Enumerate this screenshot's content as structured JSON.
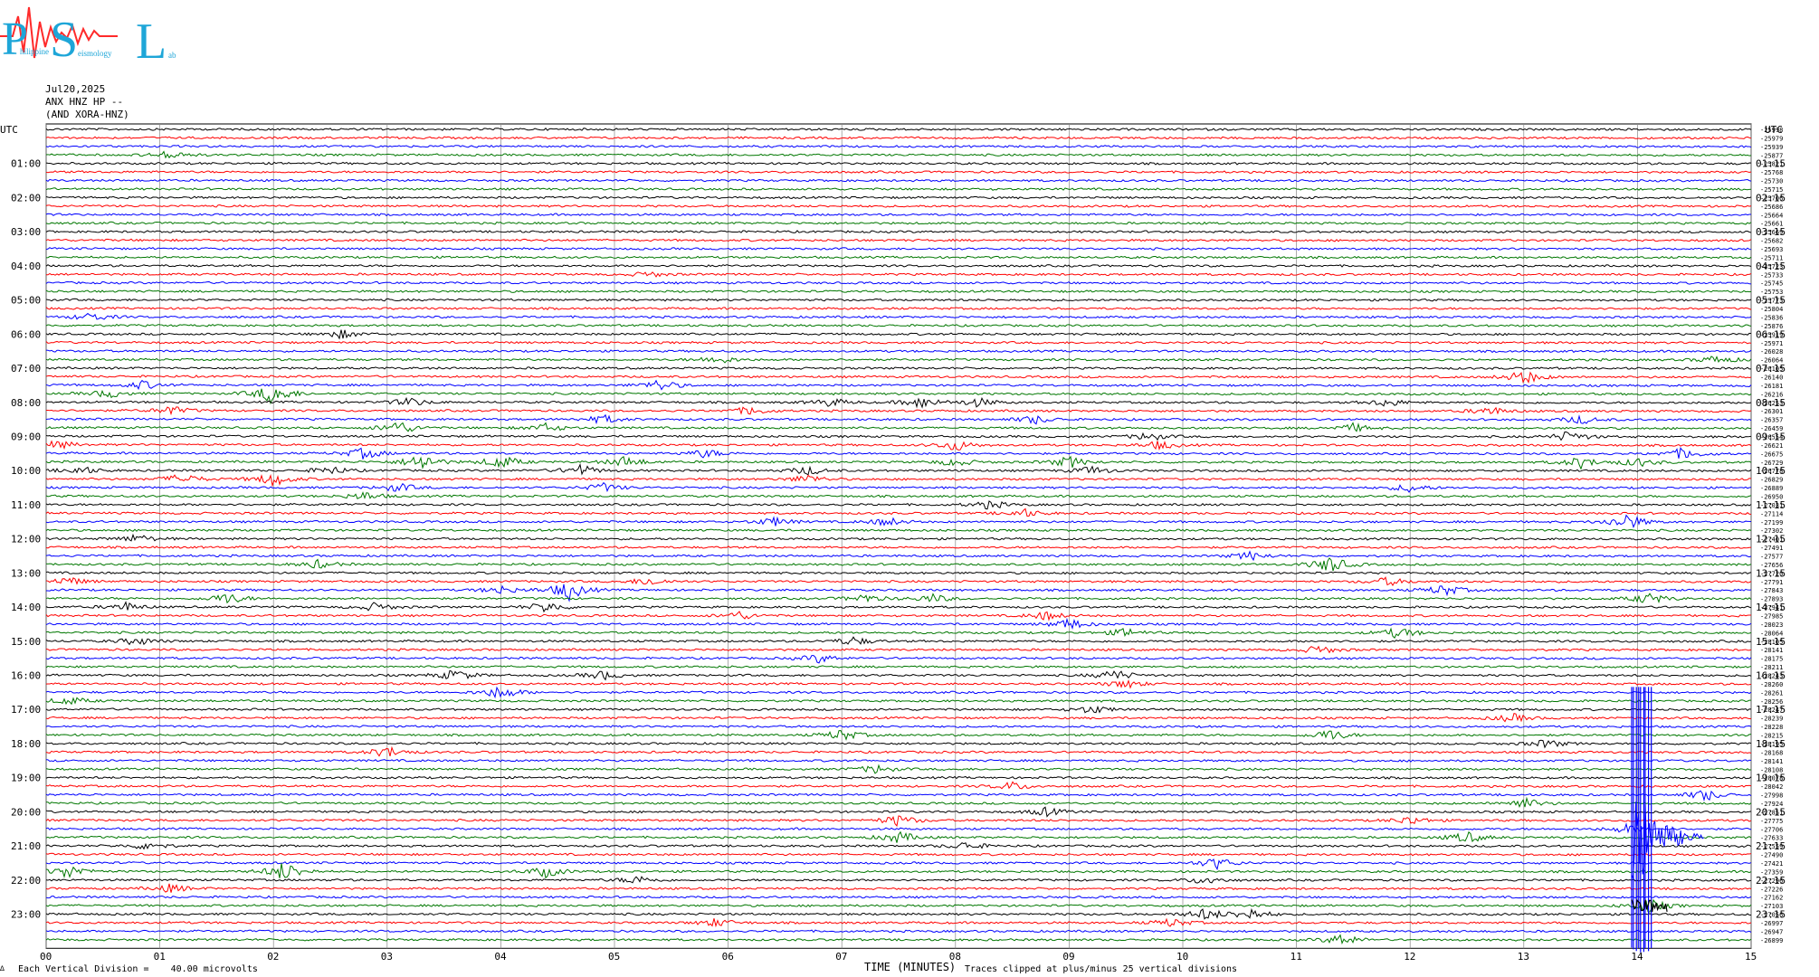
{
  "logo": {
    "letters": [
      "P",
      "S",
      "L"
    ],
    "tail_text": [
      "hilippine",
      "eismology",
      "ab"
    ]
  },
  "header": {
    "date": "Jul20,2025",
    "station": "ANX HNZ HP --",
    "network": "(AND XORA-HNZ)"
  },
  "footer": {
    "scale_prefix": "∆",
    "vertical_division": "Each Vertical Division =    40.00 microvolts",
    "x_label": "TIME (MINUTES)",
    "clip_note": "Traces clipped at plus/minus 25 vertical divisions"
  },
  "colors": {
    "trace_cycle": [
      "#000000",
      "#ff0000",
      "#0000ff",
      "#007700"
    ],
    "grid": "#888888",
    "logo_blue": "#1ea6d8",
    "logo_red": "#ff2a2a"
  },
  "chart_data": {
    "type": "helicorder",
    "corner_labels": {
      "left": "UTC",
      "right": "UTC"
    },
    "x_ticks": [
      "00",
      "01",
      "02",
      "03",
      "04",
      "05",
      "06",
      "07",
      "08",
      "09",
      "10",
      "11",
      "12",
      "13",
      "14",
      "15"
    ],
    "xlim": [
      0,
      15
    ],
    "trace_count": 96,
    "minutes_per_trace": 15,
    "left_hour_labels": [
      "01:00",
      "02:00",
      "03:00",
      "04:00",
      "05:00",
      "06:00",
      "07:00",
      "08:00",
      "09:00",
      "10:00",
      "11:00",
      "12:00",
      "13:00",
      "14:00",
      "15:00",
      "16:00",
      "17:00",
      "18:00",
      "19:00",
      "20:00",
      "21:00",
      "22:00",
      "23:00"
    ],
    "right_hour_labels": [
      "01:15",
      "02:15",
      "03:15",
      "04:15",
      "05:15",
      "06:15",
      "07:15",
      "08:15",
      "09:15",
      "10:15",
      "11:15",
      "12:15",
      "13:15",
      "14:15",
      "15:15",
      "16:15",
      "17:15",
      "18:15",
      "19:15",
      "20:15",
      "21:15",
      "22:15",
      "23:15"
    ],
    "right_offsets": [
      "-25998",
      "-25979",
      "-25939",
      "-25877",
      "-25821",
      "-25768",
      "-25730",
      "-25715",
      "-25706",
      "-25686",
      "-25664",
      "-25661",
      "-25669",
      "-25682",
      "-25693",
      "-25711",
      "-25723",
      "-25733",
      "-25745",
      "-25753",
      "-25773",
      "-25804",
      "-25836",
      "-25876",
      "-25919",
      "-25971",
      "-26028",
      "-26064",
      "-26105",
      "-26140",
      "-26181",
      "-26216",
      "-26253",
      "-26301",
      "-26357",
      "-26459",
      "-26554",
      "-26621",
      "-26675",
      "-26729",
      "-26778",
      "-26829",
      "-26889",
      "-26950",
      "-27031",
      "-27114",
      "-27199",
      "-27302",
      "-27401",
      "-27491",
      "-27577",
      "-27656",
      "-27720",
      "-27791",
      "-27843",
      "-27893",
      "-27941",
      "-27985",
      "-28023",
      "-28064",
      "-28105",
      "-28141",
      "-28175",
      "-28211",
      "-28243",
      "-28260",
      "-28261",
      "-28256",
      "-28247",
      "-28239",
      "-28228",
      "-28215",
      "-28195",
      "-28168",
      "-28141",
      "-28108",
      "-28078",
      "-28042",
      "-27998",
      "-27924",
      "-27851",
      "-27775",
      "-27706",
      "-27633",
      "-27559",
      "-27490",
      "-27421",
      "-27359",
      "-27296",
      "-27226",
      "-27162",
      "-27103",
      "-27056",
      "-26997",
      "-26947",
      "-26899"
    ],
    "events": [
      {
        "trace": 3,
        "minute": 1.1,
        "amp": 3
      },
      {
        "trace": 17,
        "minute": 5.3,
        "amp": 2
      },
      {
        "trace": 22,
        "minute": 0.4,
        "amp": 3
      },
      {
        "trace": 24,
        "minute": 2.6,
        "amp": 3
      },
      {
        "trace": 27,
        "minute": 5.9,
        "amp": 3
      },
      {
        "trace": 29,
        "minute": 13.0,
        "amp": 5
      },
      {
        "trace": 27,
        "minute": 14.7,
        "amp": 3
      },
      {
        "trace": 30,
        "minute": 0.85,
        "amp": 3
      },
      {
        "trace": 30,
        "minute": 5.4,
        "amp": 4
      },
      {
        "trace": 31,
        "minute": 0.55,
        "amp": 3
      },
      {
        "trace": 31,
        "minute": 2.0,
        "amp": 8
      },
      {
        "trace": 32,
        "minute": 6.9,
        "amp": 3
      },
      {
        "trace": 32,
        "minute": 7.7,
        "amp": 4
      },
      {
        "trace": 32,
        "minute": 8.2,
        "amp": 3
      },
      {
        "trace": 32,
        "minute": 11.8,
        "amp": 3
      },
      {
        "trace": 32,
        "minute": 3.2,
        "amp": 3
      },
      {
        "trace": 33,
        "minute": 1.1,
        "amp": 3
      },
      {
        "trace": 33,
        "minute": 6.2,
        "amp": 3
      },
      {
        "trace": 33,
        "minute": 12.7,
        "amp": 3
      },
      {
        "trace": 34,
        "minute": 4.9,
        "amp": 3
      },
      {
        "trace": 34,
        "minute": 8.7,
        "amp": 3
      },
      {
        "trace": 34,
        "minute": 13.5,
        "amp": 3
      },
      {
        "trace": 35,
        "minute": 3.1,
        "amp": 5
      },
      {
        "trace": 35,
        "minute": 11.5,
        "amp": 3
      },
      {
        "trace": 35,
        "minute": 4.4,
        "amp": 3
      },
      {
        "trace": 36,
        "minute": 9.7,
        "amp": 3
      },
      {
        "trace": 36,
        "minute": 13.4,
        "amp": 4
      },
      {
        "trace": 37,
        "minute": 0.1,
        "amp": 3
      },
      {
        "trace": 37,
        "minute": 8.0,
        "amp": 4
      },
      {
        "trace": 37,
        "minute": 9.8,
        "amp": 3
      },
      {
        "trace": 38,
        "minute": 2.8,
        "amp": 4
      },
      {
        "trace": 38,
        "minute": 5.8,
        "amp": 3
      },
      {
        "trace": 38,
        "minute": 14.4,
        "amp": 4
      },
      {
        "trace": 39,
        "minute": 3.3,
        "amp": 6
      },
      {
        "trace": 39,
        "minute": 4.0,
        "amp": 5
      },
      {
        "trace": 39,
        "minute": 5.1,
        "amp": 4
      },
      {
        "trace": 39,
        "minute": 8.0,
        "amp": 3
      },
      {
        "trace": 39,
        "minute": 9.0,
        "amp": 4
      },
      {
        "trace": 39,
        "minute": 13.5,
        "amp": 4
      },
      {
        "trace": 39,
        "minute": 14.0,
        "amp": 3
      },
      {
        "trace": 40,
        "minute": 0.3,
        "amp": 3
      },
      {
        "trace": 40,
        "minute": 2.5,
        "amp": 3
      },
      {
        "trace": 40,
        "minute": 4.7,
        "amp": 4
      },
      {
        "trace": 40,
        "minute": 6.7,
        "amp": 3
      },
      {
        "trace": 40,
        "minute": 9.2,
        "amp": 3
      },
      {
        "trace": 41,
        "minute": 1.2,
        "amp": 4
      },
      {
        "trace": 41,
        "minute": 2.0,
        "amp": 5
      },
      {
        "trace": 41,
        "minute": 6.7,
        "amp": 3
      },
      {
        "trace": 42,
        "minute": 3.1,
        "amp": 3
      },
      {
        "trace": 42,
        "minute": 4.9,
        "amp": 3
      },
      {
        "trace": 42,
        "minute": 12.0,
        "amp": 3
      },
      {
        "trace": 43,
        "minute": 2.8,
        "amp": 3
      },
      {
        "trace": 44,
        "minute": 8.3,
        "amp": 3
      },
      {
        "trace": 45,
        "minute": 8.6,
        "amp": 3
      },
      {
        "trace": 46,
        "minute": 6.4,
        "amp": 3
      },
      {
        "trace": 46,
        "minute": 7.4,
        "amp": 3
      },
      {
        "trace": 46,
        "minute": 13.9,
        "amp": 6
      },
      {
        "trace": 48,
        "minute": 0.8,
        "amp": 3
      },
      {
        "trace": 50,
        "minute": 10.6,
        "amp": 3
      },
      {
        "trace": 51,
        "minute": 11.3,
        "amp": 6
      },
      {
        "trace": 51,
        "minute": 2.4,
        "amp": 3
      },
      {
        "trace": 53,
        "minute": 0.2,
        "amp": 3
      },
      {
        "trace": 53,
        "minute": 11.8,
        "amp": 3
      },
      {
        "trace": 53,
        "minute": 5.3,
        "amp": 3
      },
      {
        "trace": 54,
        "minute": 4.0,
        "amp": 3
      },
      {
        "trace": 54,
        "minute": 4.6,
        "amp": 7
      },
      {
        "trace": 54,
        "minute": 12.3,
        "amp": 4
      },
      {
        "trace": 55,
        "minute": 1.6,
        "amp": 4
      },
      {
        "trace": 55,
        "minute": 7.2,
        "amp": 3
      },
      {
        "trace": 55,
        "minute": 7.8,
        "amp": 3
      },
      {
        "trace": 55,
        "minute": 14.1,
        "amp": 4
      },
      {
        "trace": 56,
        "minute": 0.7,
        "amp": 3
      },
      {
        "trace": 56,
        "minute": 2.9,
        "amp": 3
      },
      {
        "trace": 56,
        "minute": 4.4,
        "amp": 4
      },
      {
        "trace": 57,
        "minute": 6.1,
        "amp": 3
      },
      {
        "trace": 57,
        "minute": 8.8,
        "amp": 3
      },
      {
        "trace": 58,
        "minute": 9.0,
        "amp": 4
      },
      {
        "trace": 59,
        "minute": 9.5,
        "amp": 3
      },
      {
        "trace": 59,
        "minute": 11.9,
        "amp": 4
      },
      {
        "trace": 60,
        "minute": 0.8,
        "amp": 3
      },
      {
        "trace": 60,
        "minute": 7.1,
        "amp": 3
      },
      {
        "trace": 61,
        "minute": 11.2,
        "amp": 3
      },
      {
        "trace": 62,
        "minute": 6.8,
        "amp": 3
      },
      {
        "trace": 64,
        "minute": 3.6,
        "amp": 4
      },
      {
        "trace": 64,
        "minute": 4.9,
        "amp": 3
      },
      {
        "trace": 64,
        "minute": 9.4,
        "amp": 4
      },
      {
        "trace": 65,
        "minute": 9.5,
        "amp": 3
      },
      {
        "trace": 66,
        "minute": 4.0,
        "amp": 5
      },
      {
        "trace": 67,
        "minute": 0.2,
        "amp": 3
      },
      {
        "trace": 68,
        "minute": 9.2,
        "amp": 3
      },
      {
        "trace": 69,
        "minute": 12.9,
        "amp": 3
      },
      {
        "trace": 71,
        "minute": 7.0,
        "amp": 4
      },
      {
        "trace": 71,
        "minute": 11.3,
        "amp": 4
      },
      {
        "trace": 72,
        "minute": 13.2,
        "amp": 3
      },
      {
        "trace": 73,
        "minute": 3.0,
        "amp": 4
      },
      {
        "trace": 75,
        "minute": 7.3,
        "amp": 3
      },
      {
        "trace": 77,
        "minute": 8.5,
        "amp": 3
      },
      {
        "trace": 78,
        "minute": 14.6,
        "amp": 4
      },
      {
        "trace": 79,
        "minute": 13.0,
        "amp": 4
      },
      {
        "trace": 80,
        "minute": 8.8,
        "amp": 3
      },
      {
        "trace": 81,
        "minute": 12.0,
        "amp": 3
      },
      {
        "trace": 81,
        "minute": 7.5,
        "amp": 4
      },
      {
        "trace": 82,
        "minute": 13.9,
        "amp": 3
      },
      {
        "trace": 83,
        "minute": 7.5,
        "amp": 4
      },
      {
        "trace": 83,
        "minute": 12.5,
        "amp": 4
      },
      {
        "trace": 84,
        "minute": 0.9,
        "amp": 3
      },
      {
        "trace": 84,
        "minute": 8.1,
        "amp": 3
      },
      {
        "trace": 86,
        "minute": 10.3,
        "amp": 4
      },
      {
        "trace": 87,
        "minute": 0.2,
        "amp": 5
      },
      {
        "trace": 87,
        "minute": 2.1,
        "amp": 7
      },
      {
        "trace": 87,
        "minute": 4.4,
        "amp": 4
      },
      {
        "trace": 88,
        "minute": 5.2,
        "amp": 3
      },
      {
        "trace": 88,
        "minute": 10.2,
        "amp": 3
      },
      {
        "trace": 89,
        "minute": 1.1,
        "amp": 3
      },
      {
        "trace": 91,
        "minute": 14.1,
        "amp": 5
      },
      {
        "trace": 92,
        "minute": 10.2,
        "amp": 4
      },
      {
        "trace": 92,
        "minute": 10.6,
        "amp": 4
      },
      {
        "trace": 93,
        "minute": 5.9,
        "amp": 3
      },
      {
        "trace": 93,
        "minute": 9.9,
        "amp": 3
      },
      {
        "trace": 95,
        "minute": 11.4,
        "amp": 4
      }
    ],
    "large_event": {
      "trace": 66,
      "minute": 13.95,
      "clipped_through_trace": 95
    }
  }
}
